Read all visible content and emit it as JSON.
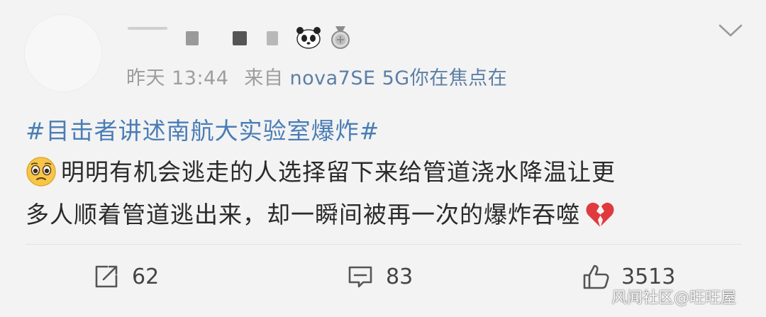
{
  "post": {
    "meta": {
      "time": "昨天 13:44",
      "source_prefix": "来自",
      "device": "nova7SE 5G你在焦点在"
    },
    "content": {
      "topic": "#目击者讲述南航大实验室爆炸#",
      "line1": "明明有机会逃走的人选择留下来给管道浇水降温让更",
      "line2": "多人顺着管道逃出来，却一瞬间被再一次的爆炸吞噬"
    },
    "actions": {
      "repost_count": "62",
      "comment_count": "83",
      "like_count": "3513"
    }
  },
  "watermark": "风闻社区@旺旺屋",
  "colors": {
    "background": "#f3f3f3",
    "topic": "#4a7db5",
    "meta": "#9d9d9d",
    "text": "#2b2b2b"
  },
  "icons": [
    "avatar",
    "panda-badge-icon",
    "medal-icon",
    "chevron-down-icon",
    "pleading-face-emoji-icon",
    "broken-heart-emoji-icon",
    "repost-icon",
    "comment-icon",
    "like-icon"
  ]
}
